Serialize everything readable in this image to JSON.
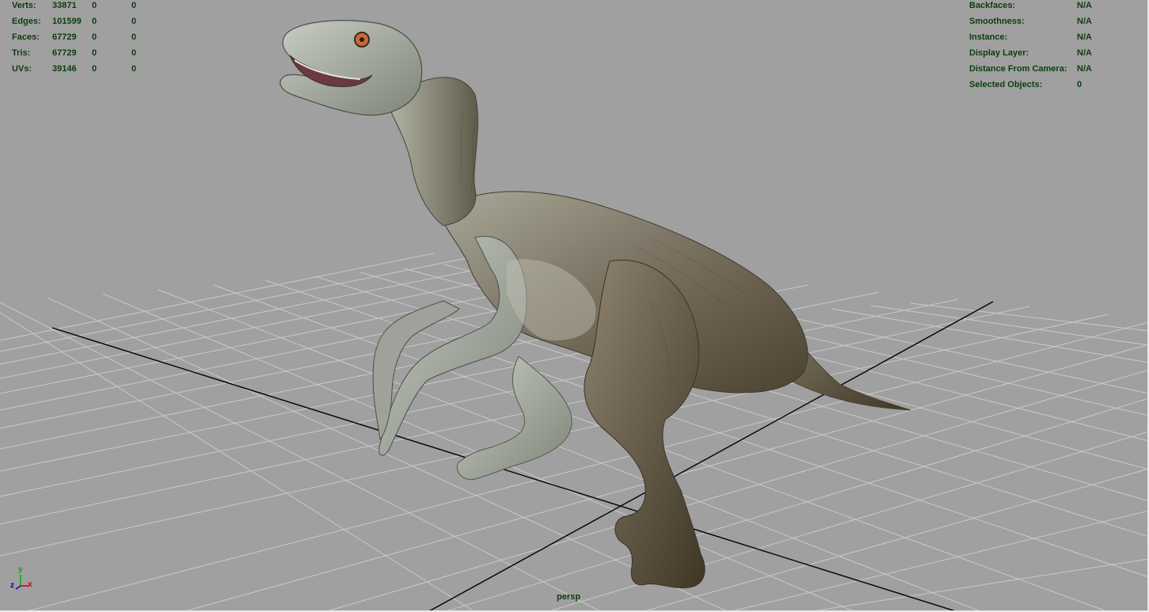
{
  "hud_left": {
    "rows": [
      {
        "label": "Verts:",
        "values": [
          "33871",
          "0",
          "0"
        ]
      },
      {
        "label": "Edges:",
        "values": [
          "101599",
          "0",
          "0"
        ]
      },
      {
        "label": "Faces:",
        "values": [
          "67729",
          "0",
          "0"
        ]
      },
      {
        "label": "Tris:",
        "values": [
          "67729",
          "0",
          "0"
        ]
      },
      {
        "label": "UVs:",
        "values": [
          "39146",
          "0",
          "0"
        ]
      }
    ]
  },
  "hud_right": {
    "rows": [
      {
        "label": "Backfaces:",
        "value": "N/A"
      },
      {
        "label": "Smoothness:",
        "value": "N/A"
      },
      {
        "label": "Instance:",
        "value": "N/A"
      },
      {
        "label": "Display Layer:",
        "value": "N/A"
      },
      {
        "label": "Distance From Camera:",
        "value": "N/A"
      },
      {
        "label": "Selected Objects:",
        "value": "0"
      }
    ]
  },
  "camera": {
    "name": "persp"
  },
  "axis_gizmo": {
    "y": "y",
    "z": "z",
    "x": "x"
  },
  "colors": {
    "viewport_bg": "#a0a0a0",
    "grid_line": "#c8c8c8",
    "grid_axis": "#000000",
    "hud_text": "#0c3d0c",
    "gizmo_x": "#cc0000",
    "gizmo_y": "#00aa00",
    "gizmo_z": "#0000cc"
  }
}
